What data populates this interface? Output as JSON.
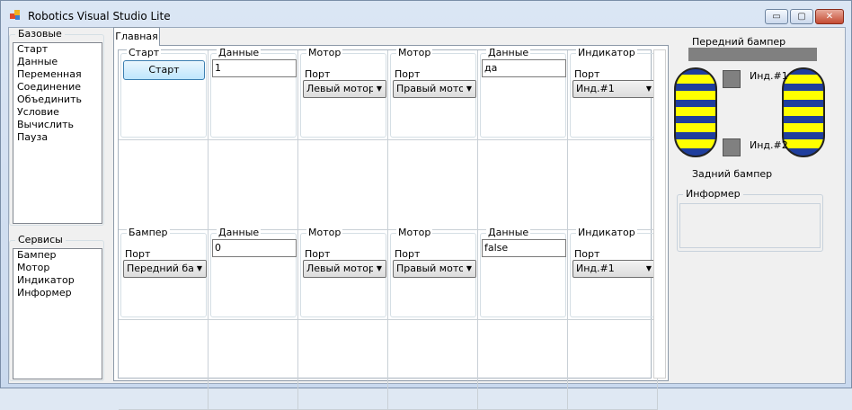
{
  "window": {
    "title": "Robotics Visual Studio Lite",
    "minimize": "▭",
    "maximize": "▢",
    "close": "✕"
  },
  "panels": {
    "base": {
      "title": "Базовые",
      "items": [
        "Старт",
        "Данные",
        "Переменная",
        "Соединение",
        "Объединить",
        "Условие",
        "Вычислить",
        "Пауза"
      ]
    },
    "services": {
      "title": "Сервисы",
      "items": [
        "Бампер",
        "Мотор",
        "Индикатор",
        "Информер"
      ]
    }
  },
  "tabs": [
    {
      "label": "Главная"
    }
  ],
  "rows": [
    {
      "blocks": [
        {
          "title": "Старт",
          "button": "Старт"
        },
        {
          "title": "Данные",
          "value": "1"
        },
        {
          "title": "Мотор",
          "port_label": "Порт",
          "selected": "Левый мотор"
        },
        {
          "title": "Мотор",
          "port_label": "Порт",
          "selected": "Правый мотор"
        },
        {
          "title": "Данные",
          "value": "да"
        },
        {
          "title": "Индикатор",
          "port_label": "Порт",
          "selected": "Инд.#1"
        }
      ]
    },
    {
      "blocks": [
        {
          "title": "Бампер",
          "port_label": "Порт",
          "selected": "Передний бампер"
        },
        {
          "title": "Данные",
          "value": "0"
        },
        {
          "title": "Мотор",
          "port_label": "Порт",
          "selected": "Левый мотор"
        },
        {
          "title": "Мотор",
          "port_label": "Порт",
          "selected": "Правый мотор"
        },
        {
          "title": "Данные",
          "value": "false"
        },
        {
          "title": "Индикатор",
          "port_label": "Порт",
          "selected": "Инд.#1"
        }
      ]
    }
  ],
  "robot": {
    "front_bumper_label": "Передний бампер",
    "rear_bumper_label": "Задний бампер",
    "indicator1_label": "Инд.#1",
    "indicator2_label": "Инд.#2",
    "informer_title": "Информер",
    "colors": {
      "wheel": "#1f3e9d",
      "stripe": "#ffff00",
      "bumper": "#808080"
    }
  }
}
